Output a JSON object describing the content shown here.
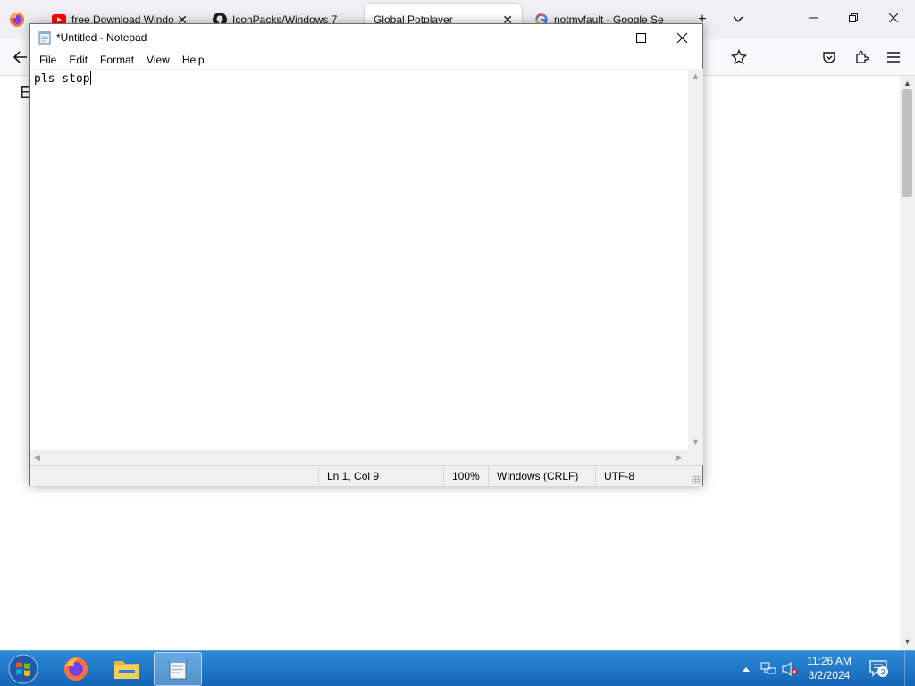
{
  "browser": {
    "tabs": [
      {
        "title": "free Download Windo",
        "favicon": "youtube-icon"
      },
      {
        "title": "IconPacks/Windows 7",
        "favicon": "github-icon"
      },
      {
        "title": "Global Potplayer",
        "favicon": "none",
        "active": true
      },
      {
        "title": "notmyfault - Google Se",
        "favicon": "google-icon"
      }
    ],
    "page_heading_fragment": "E"
  },
  "notepad": {
    "title": "*Untitled - Notepad",
    "menu": [
      "File",
      "Edit",
      "Format",
      "View",
      "Help"
    ],
    "content": "pls stop",
    "status": {
      "position": "Ln 1, Col 9",
      "zoom": "100%",
      "line_endings": "Windows (CRLF)",
      "encoding": "UTF-8"
    }
  },
  "taskbar": {
    "apps": [
      {
        "name": "firefox-icon"
      },
      {
        "name": "file-explorer-icon"
      },
      {
        "name": "notepad-icon",
        "active": true
      }
    ],
    "clock": {
      "time": "11:26 AM",
      "date": "3/2/2024"
    },
    "notifications_count": "3"
  },
  "colors": {
    "taskbar_top": "#2d8ad6",
    "taskbar_bottom": "#1566b8",
    "tabstrip_bg": "#f0f0f4",
    "youtube_red": "#ff0000"
  }
}
